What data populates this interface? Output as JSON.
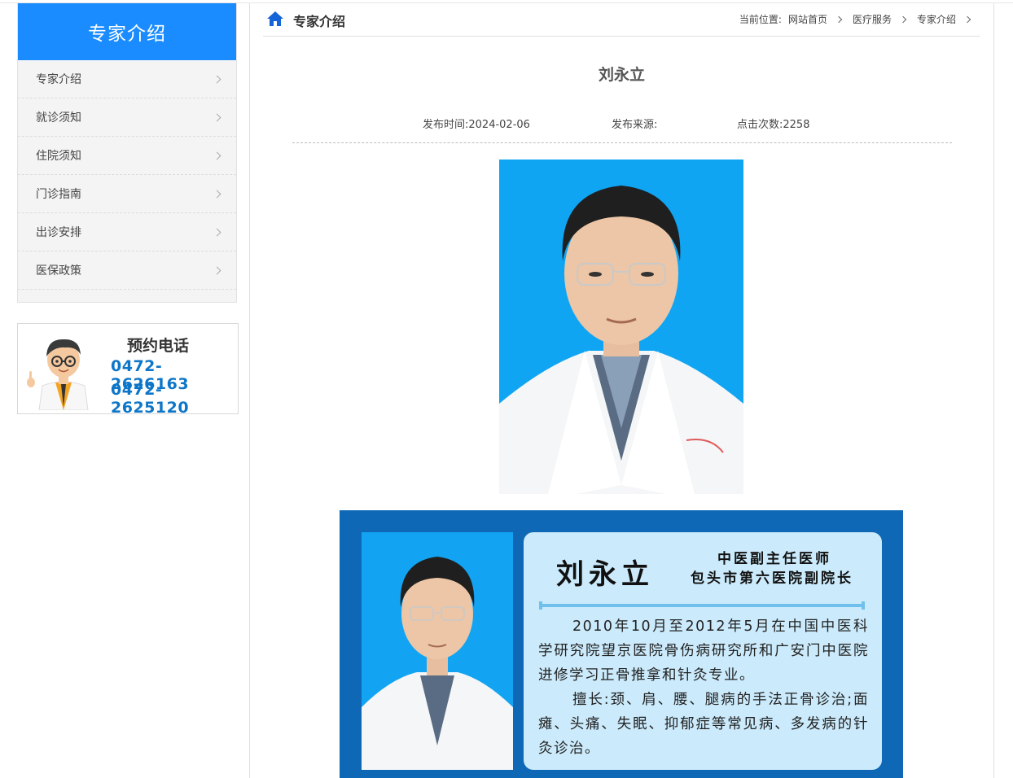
{
  "sidebar": {
    "title": "专家介绍",
    "items": [
      {
        "label": "专家介绍"
      },
      {
        "label": "就诊须知"
      },
      {
        "label": "住院须知"
      },
      {
        "label": "门诊指南"
      },
      {
        "label": "出诊安排"
      },
      {
        "label": "医保政策"
      }
    ]
  },
  "appointment": {
    "title": "预约电话",
    "phones": [
      "0472-2626163",
      "0472-2625120"
    ]
  },
  "header": {
    "section_title": "专家介绍",
    "breadcrumb": {
      "prefix": "当前位置:",
      "items": [
        "网站首页",
        "医疗服务",
        "专家介绍"
      ]
    }
  },
  "article": {
    "title": "刘永立",
    "publish_time": "发布时间:2024-02-06",
    "source": "发布来源:",
    "views": "点击次数:2258"
  },
  "card": {
    "name": "刘永立",
    "role1": "中医副主任医师",
    "role2": "包头市第六医院副院长",
    "para1": "2010年10月至2012年5月在中国中医科学研究院望京医院骨伤病研究所和广安门中医院进修学习正骨推拿和针灸专业。",
    "para2": "擅长:颈、肩、腰、腿病的手法正骨诊治;面瘫、头痛、失眠、抑郁症等常见病、多发病的针灸诊治。"
  },
  "colors": {
    "accent": "#1a8cff",
    "phone": "#0d76c8",
    "card_bg": "#0e68b6",
    "card_panel": "#cbeafb"
  }
}
